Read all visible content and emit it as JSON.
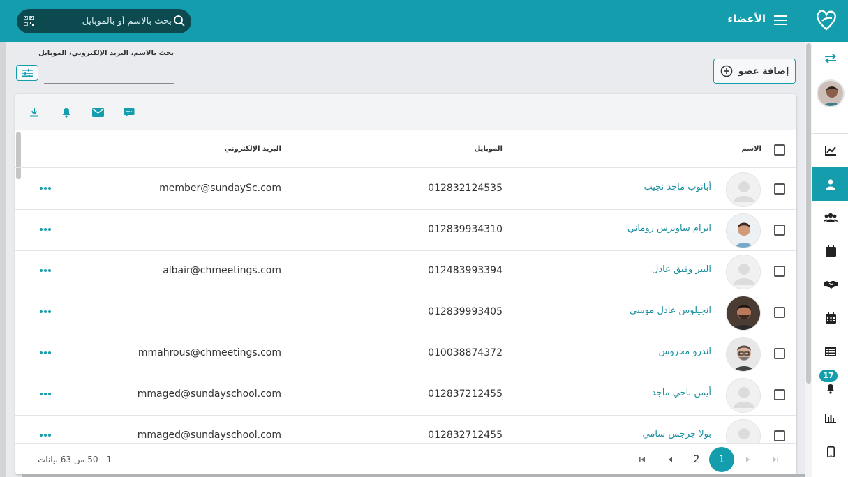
{
  "header": {
    "title": "الأعضاء",
    "search_placeholder": "بحث بالاسم أو بالموبايل",
    "icons": [
      "qr-code-icon",
      "search-icon",
      "hamburger-menu-icon",
      "app-logo"
    ]
  },
  "colors": {
    "accent": "#149ead",
    "search_bg": "#0c4a50",
    "link": "#1a8fa0"
  },
  "controls": {
    "search_label": "بحث بالاسم، البريد الإلكتروني، الموبايل",
    "add_member_label": "إضافة عضو"
  },
  "toolbar_icons": [
    "download-icon",
    "bell-icon",
    "email-icon",
    "chat-icon"
  ],
  "table": {
    "headers": {
      "name": "الاسم",
      "mobile": "الموبايل",
      "email": "البريد الإلكتروني"
    },
    "rows": [
      {
        "name": "أبانوب ماجد نجيب",
        "mobile": "012832124535",
        "email": "member@sundaySc.com",
        "avatar": "placeholder"
      },
      {
        "name": "ابرام ساويرس روماني",
        "mobile": "012839934310",
        "email": "",
        "avatar": "photo"
      },
      {
        "name": "البير وفيق عادل",
        "mobile": "012483993394",
        "email": "albair@chmeetings.com",
        "avatar": "placeholder"
      },
      {
        "name": "انجيلوس عادل موسى",
        "mobile": "012839993405",
        "email": "",
        "avatar": "photo"
      },
      {
        "name": "اندرو محروس",
        "mobile": "010038874372",
        "email": "mmahrous@chmeetings.com",
        "avatar": "photo"
      },
      {
        "name": "أيمن ناجي ماجد",
        "mobile": "012837212455",
        "email": "mmaged@sundayschool.com",
        "avatar": "placeholder"
      },
      {
        "name": "بولا جرجس سامي",
        "mobile": "012832712455",
        "email": "mmaged@sundayschool.com",
        "avatar": "placeholder"
      }
    ]
  },
  "pagination": {
    "range_text": "1 - 50 من 63 بيانات",
    "pages": [
      "1",
      "2"
    ],
    "current_page": "1"
  },
  "sidebar": {
    "items": [
      "swap-icon",
      "profile-avatar",
      "dashboard-chart-icon",
      "members-icon",
      "groups-icon",
      "events-calendar-icon",
      "handshake-icon",
      "schedule-icon",
      "list-icon",
      "notifications-bell-icon",
      "reports-bar-chart-icon",
      "mobile-app-icon"
    ],
    "active": "members-icon",
    "notification_count": "17"
  }
}
